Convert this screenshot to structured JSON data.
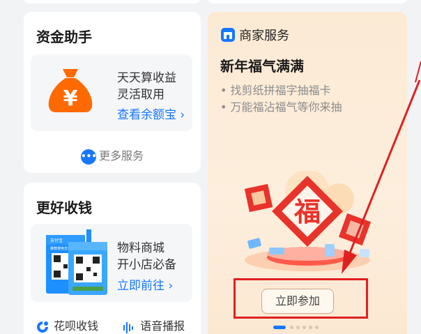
{
  "asset_card": {
    "title": "资金助手",
    "line1": "天天算收益",
    "line2": "灵活取用",
    "link": "查看余额宝",
    "more": "更多服务",
    "bag_symbol": "¥"
  },
  "collect_card": {
    "title": "更好收钱",
    "line1": "物料商城",
    "line2": "开小店必备",
    "link": "立即前往",
    "stand_brand": "支付宝",
    "stand_caption": "推荐使用支付宝",
    "footer_left": "花呗收钱",
    "footer_right": "语音播报"
  },
  "merchant_card": {
    "header": "商家服务",
    "title": "新年福气满满",
    "bullets": [
      "找剪纸拼福字抽福卡",
      "万能福沾福气等你来抽"
    ],
    "fu_char": "福",
    "join_button": "立即参加",
    "carousel_count": 6,
    "carousel_active": 0
  },
  "colors": {
    "accent_blue": "#1677ff",
    "bag_orange": "#ff6a00",
    "annotation_red": "#e02020"
  }
}
